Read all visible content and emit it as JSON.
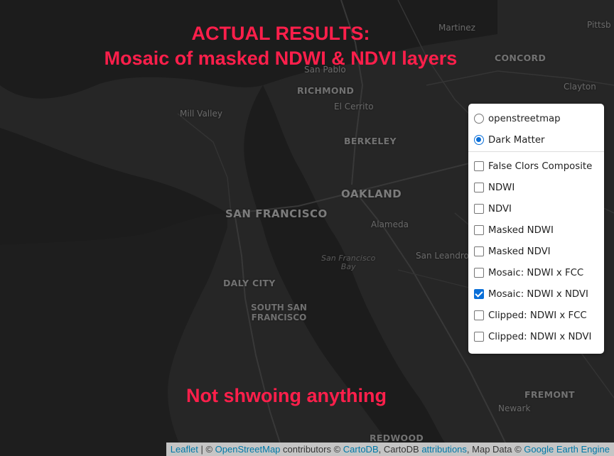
{
  "overlay": {
    "title_line1": "ACTUAL RESULTS:",
    "title_line2": "Mosaic of masked NDWI & NDVI layers",
    "bottom_note": "Not shwoing anything"
  },
  "map": {
    "tile_style": "Dark Matter",
    "colors": {
      "land": "#262626",
      "water": "#1a1a1a",
      "road": "#3a3a3a",
      "label": "#6e6e6e",
      "annotation": "#ff1f4b"
    },
    "places": {
      "martinez": "Martinez",
      "pittsburg": "Pittsb",
      "concord": "CONCORD",
      "san_pablo": "San Pablo",
      "richmond": "RICHMOND",
      "clayton": "Clayton",
      "el_cerrito": "El Cerrito",
      "mill_valley": "Mill Valley",
      "berkeley": "BERKELEY",
      "oakland": "OAKLAND",
      "san_francisco": "SAN FRANCISCO",
      "alameda": "Alameda",
      "sf_bay_line1": "San Francisco",
      "sf_bay_line2": "Bay",
      "san_leandro": "San Leandro",
      "daly_city": "DALY CITY",
      "south_sf_line1": "SOUTH SAN",
      "south_sf_line2": "FRANCISCO",
      "fremont": "FREMONT",
      "newark": "Newark",
      "redwood": "REDWOOD"
    }
  },
  "layer_control": {
    "base_layers": [
      {
        "label": "openstreetmap",
        "selected": false
      },
      {
        "label": "Dark Matter",
        "selected": true
      }
    ],
    "overlays": [
      {
        "label": "False Clors Composite",
        "checked": false
      },
      {
        "label": "NDWI",
        "checked": false
      },
      {
        "label": "NDVI",
        "checked": false
      },
      {
        "label": "Masked NDWI",
        "checked": false
      },
      {
        "label": "Masked NDVI",
        "checked": false
      },
      {
        "label": "Mosaic: NDWI x FCC",
        "checked": false
      },
      {
        "label": "Mosaic: NDWI x NDVI",
        "checked": true
      },
      {
        "label": "Clipped: NDWI x FCC",
        "checked": false
      },
      {
        "label": "Clipped: NDWI x NDVI",
        "checked": false
      }
    ]
  },
  "attribution": {
    "leaflet": "Leaflet",
    "sep1": " | © ",
    "osm": "OpenStreetMap",
    "contrib": " contributors © ",
    "cartodb": "CartoDB",
    "mid": ", CartoDB ",
    "attributions": "attributions",
    "mapdata": ", Map Data © ",
    "gee": "Google Earth Engine"
  }
}
